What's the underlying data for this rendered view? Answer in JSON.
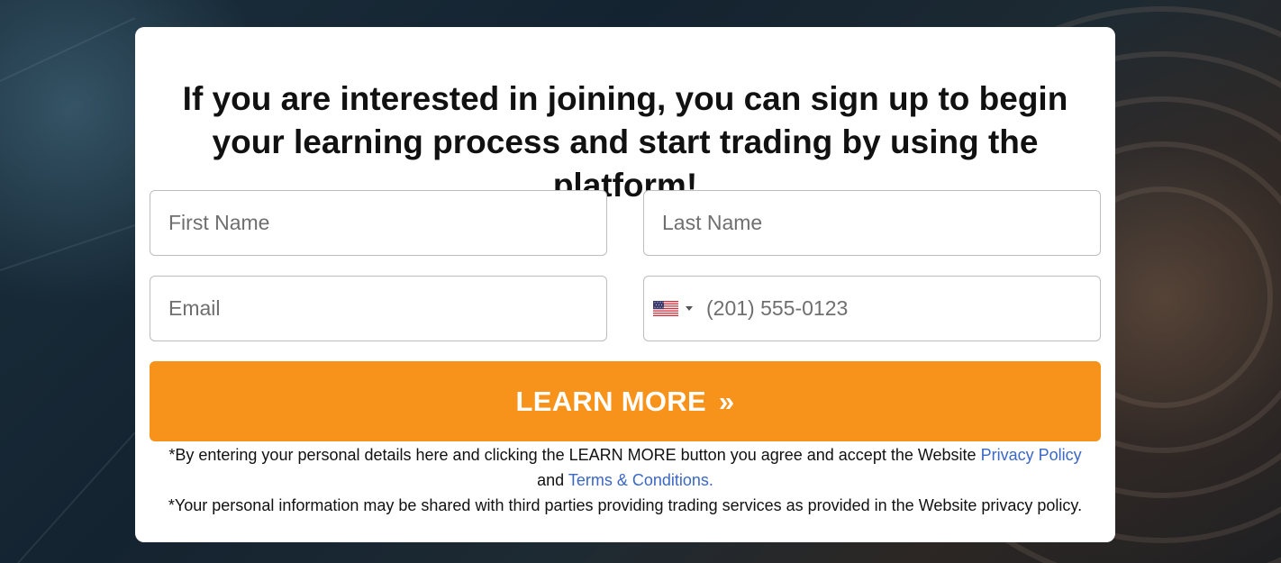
{
  "colors": {
    "accent": "#f7921a",
    "link": "#3b67c5",
    "card": "#ffffff"
  },
  "headline": "If you are interested in joining, you can sign up to begin your learning process and start trading by using the platform!",
  "form": {
    "first_name": {
      "placeholder": "First Name",
      "value": ""
    },
    "last_name": {
      "placeholder": "Last Name",
      "value": ""
    },
    "email": {
      "placeholder": "Email",
      "value": ""
    },
    "phone": {
      "placeholder": "(201) 555-0123",
      "value": "",
      "country_icon": "us-flag-icon"
    },
    "submit_label": "LEARN MORE",
    "submit_icon": "»"
  },
  "disclaimer": {
    "line1_prefix": "*By entering your personal details here and clicking the LEARN MORE button you agree and accept the Website",
    "privacy_link": "Privacy Policy",
    "line1_and": "and",
    "terms_link": "Terms & Conditions.",
    "line2": "*Your personal information may be shared with third parties providing trading services as provided in the Website privacy policy."
  }
}
